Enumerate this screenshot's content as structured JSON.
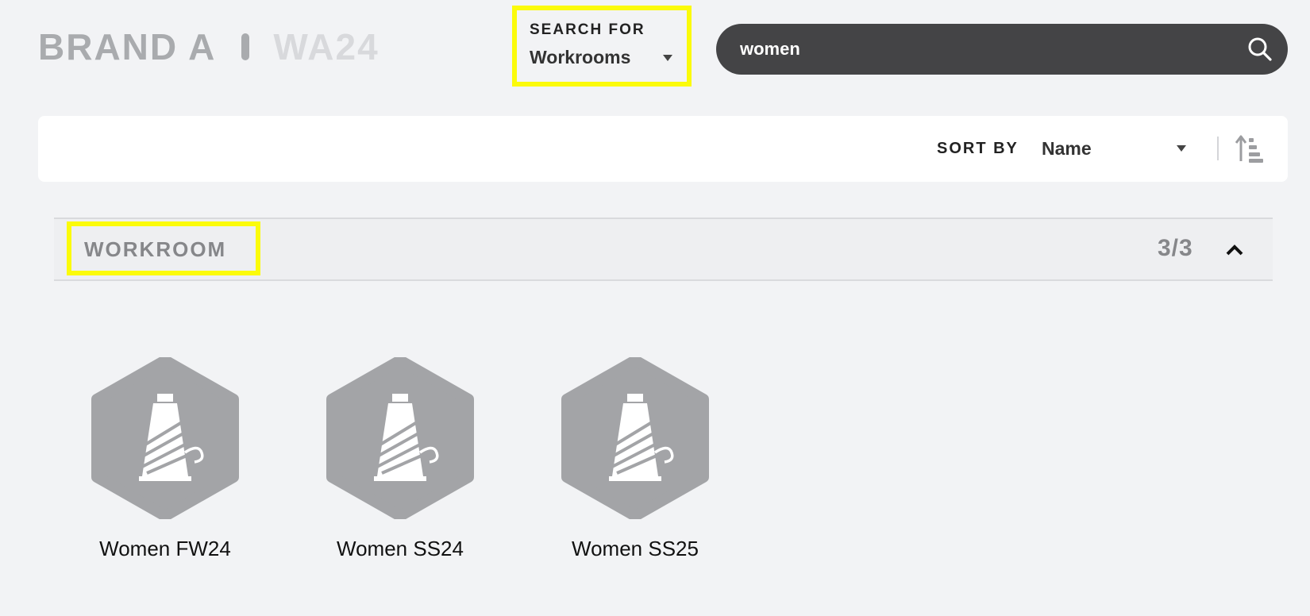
{
  "header": {
    "brand": "BRAND A",
    "season": "WA24"
  },
  "search_for": {
    "label": "SEARCH FOR",
    "value": "Workrooms"
  },
  "search": {
    "value": "women"
  },
  "sort": {
    "label": "SORT BY",
    "value": "Name"
  },
  "section": {
    "title": "WORKROOM",
    "count": "3/3"
  },
  "workrooms": [
    {
      "name": "Women FW24"
    },
    {
      "name": "Women SS24"
    },
    {
      "name": "Women SS25"
    }
  ],
  "colors": {
    "highlight": "#fbfb0a",
    "search_bg": "#444446",
    "hex_fill": "#a3a4a7",
    "page_bg": "#f2f3f5"
  },
  "icons": [
    "search-icon",
    "caret-down-icon",
    "sort-order-icon",
    "chevron-up-icon",
    "thread-spool-icon"
  ]
}
